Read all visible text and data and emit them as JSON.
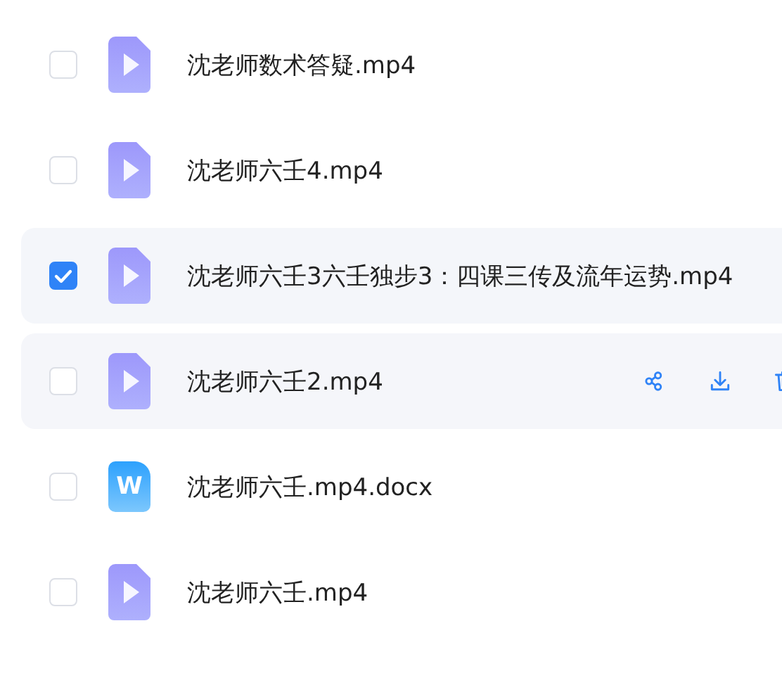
{
  "files": [
    {
      "name": "沈老师数术答疑.mp4",
      "kind": "video",
      "checked": false,
      "hovered": false
    },
    {
      "name": "沈老师六壬4.mp4",
      "kind": "video",
      "checked": false,
      "hovered": false
    },
    {
      "name": "沈老师六壬3六壬独步3：四课三传及流年运势.mp4",
      "kind": "video",
      "checked": true,
      "hovered": false
    },
    {
      "name": "沈老师六壬2.mp4",
      "kind": "video",
      "checked": false,
      "hovered": true
    },
    {
      "name": "沈老师六壬.mp4.docx",
      "kind": "word",
      "letter": "W",
      "checked": false,
      "hovered": false
    },
    {
      "name": "沈老师六壬.mp4",
      "kind": "video",
      "checked": false,
      "hovered": false
    }
  ]
}
